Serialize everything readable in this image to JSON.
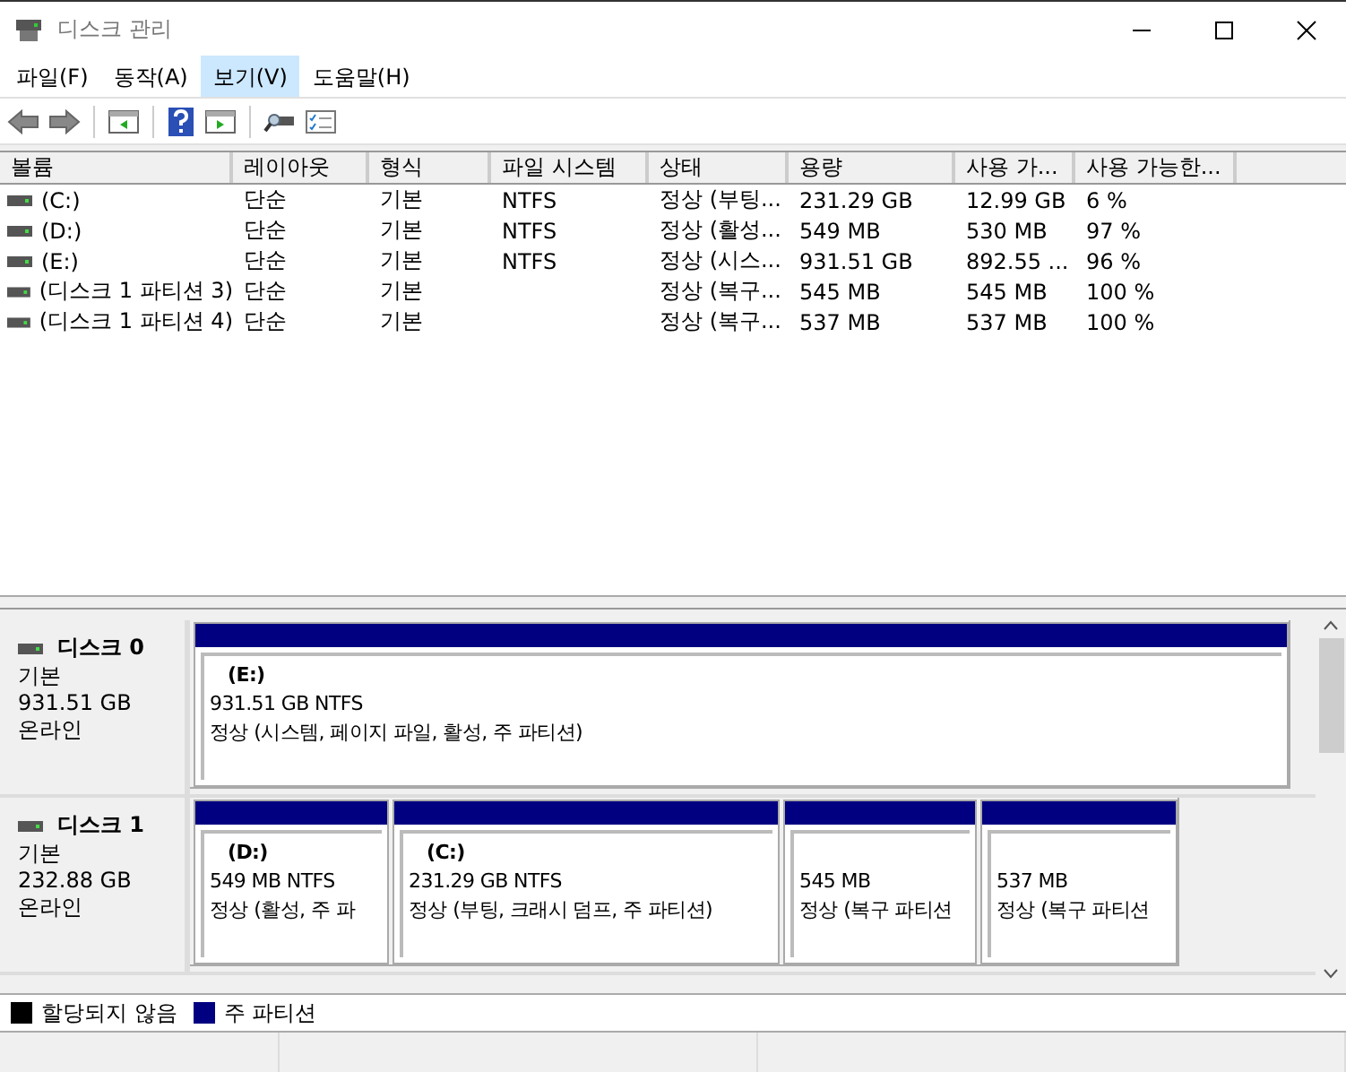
{
  "window": {
    "title": "디스크 관리"
  },
  "menu": [
    {
      "label": "파일(F)",
      "selected": false
    },
    {
      "label": "동작(A)",
      "selected": false
    },
    {
      "label": "보기(V)",
      "selected": true
    },
    {
      "label": "도움말(H)",
      "selected": false
    }
  ],
  "table": {
    "columns": [
      "볼륨",
      "레이아웃",
      "형식",
      "파일 시스템",
      "상태",
      "용량",
      "사용 가...",
      "사용 가능한..."
    ],
    "rows": [
      [
        "(C:)",
        "단순",
        "기본",
        "NTFS",
        "정상 (부팅...",
        "231.29 GB",
        "12.99 GB",
        "6 %"
      ],
      [
        "(D:)",
        "단순",
        "기본",
        "NTFS",
        "정상 (활성...",
        "549 MB",
        "530 MB",
        "97 %"
      ],
      [
        "(E:)",
        "단순",
        "기본",
        "NTFS",
        "정상 (시스...",
        "931.51 GB",
        "892.55 ...",
        "96 %"
      ],
      [
        "(디스크 1 파티션 3)",
        "단순",
        "기본",
        "",
        "정상 (복구...",
        "545 MB",
        "545 MB",
        "100 %"
      ],
      [
        "(디스크 1 파티션 4)",
        "단순",
        "기본",
        "",
        "정상 (복구...",
        "537 MB",
        "537 MB",
        "100 %"
      ]
    ]
  },
  "disks": [
    {
      "name": "디스크 0",
      "type": "기본",
      "size": "931.51 GB",
      "status": "온라인",
      "partitions": [
        {
          "label": "(E:)",
          "size": "931.51 GB NTFS",
          "status": "정상 (시스템, 페이지 파일, 활성, 주 파티션)",
          "kind": "primary"
        }
      ]
    },
    {
      "name": "디스크 1",
      "type": "기본",
      "size": "232.88 GB",
      "status": "온라인",
      "partitions": [
        {
          "label": "(D:)",
          "size": "549 MB NTFS",
          "status": "정상 (활성, 주 파",
          "kind": "primary"
        },
        {
          "label": "(C:)",
          "size": "231.29 GB NTFS",
          "status": "정상 (부팅, 크래시 덤프, 주 파티션)",
          "kind": "primary"
        },
        {
          "size": "545 MB",
          "status": "정상 (복구 파티션",
          "kind": "primary"
        },
        {
          "size": "537 MB",
          "status": "정상 (복구 파티션",
          "kind": "primary"
        }
      ]
    }
  ],
  "legend": [
    {
      "label": "할당되지 않음",
      "color": "#000000"
    },
    {
      "label": "주 파티션",
      "color": "#000080"
    }
  ]
}
